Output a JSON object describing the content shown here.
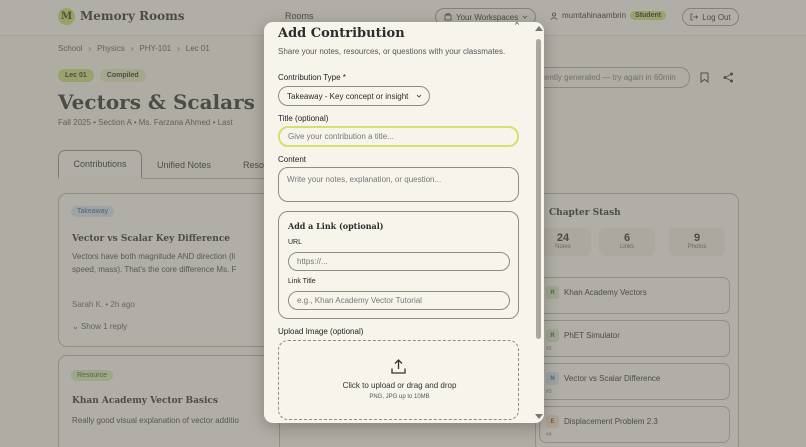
{
  "app": {
    "logo_letter": "M",
    "name": "Memory Rooms"
  },
  "nav": {
    "rooms": "Rooms",
    "workspaces": "Your Workspaces",
    "user": "mumtahinaambrin",
    "role_badge": "Student",
    "logout": "Log Out"
  },
  "breadcrumb": [
    "School",
    "Physics",
    "PHY-101",
    "Lec 01"
  ],
  "tags": {
    "lecture": "Lec 01",
    "status": "Compiled"
  },
  "page": {
    "title": "Vectors & Scalars",
    "meta": "Fall 2025 • Section A • Ms. Farzana Ahmed • Last",
    "regenerate_note": "cently generated — try again in 60min"
  },
  "tabs": {
    "contributions": "Contributions",
    "unified": "Unified Notes",
    "resources": "Reso"
  },
  "contributions": [
    {
      "chip": "Takeaway",
      "title": "Vector vs Scalar Key Difference",
      "line1": "Vectors have both magnitude AND direction (li",
      "line2": "speed, mass). That's the core difference Ms. F",
      "author": "Sarah K.",
      "time": "2h ago",
      "replies": "Show 1 reply"
    },
    {
      "chip": "Resource",
      "title": "Khan Academy Vector Basics",
      "line1": "Really good visual explanation of vector additio"
    }
  ],
  "stash": {
    "title": "Chapter Stash",
    "stats": [
      {
        "value": "24",
        "label": "Notes"
      },
      {
        "value": "6",
        "label": "Links"
      },
      {
        "value": "9",
        "label": "Photos"
      }
    ],
    "items": [
      {
        "icon": "R",
        "label": "Khan Academy Vectors",
        "code": ""
      },
      {
        "icon": "R",
        "label": "PhET Simulator",
        "code": "#2"
      },
      {
        "icon": "N",
        "label": "Vector vs Scalar Difference",
        "code": "#3"
      },
      {
        "icon": "E",
        "label": "Displacement Problem 2.3",
        "code": "#4"
      }
    ]
  },
  "modal": {
    "title": "Add Contribution",
    "subtitle": "Share your notes, resources, or questions with your classmates.",
    "close": "×",
    "type_label": "Contribution Type *",
    "type_value": "Takeaway - Key concept or insight",
    "title_label": "Title (optional)",
    "title_placeholder": "Give your contribution a title...",
    "content_label": "Content",
    "content_placeholder": "Write your notes, explanation, or question...",
    "link_section": "Add a Link (optional)",
    "url_label": "URL",
    "url_placeholder": "https://...",
    "link_title_label": "Link Title",
    "link_title_placeholder": "e.g., Khan Academy Vector Tutorial",
    "upload_label": "Upload Image (optional)",
    "upload_text": "Click to upload or drag and drop",
    "upload_hint": "PNG, JPG up to 10MB"
  },
  "colors": {
    "accent": "#c9db74",
    "focus_ring": "#d5e16e",
    "background": "#f2efe6",
    "overlay": "#6c6a62"
  }
}
